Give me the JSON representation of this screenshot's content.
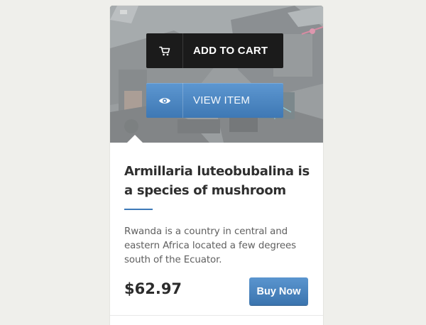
{
  "product": {
    "title": "Armillaria luteobubalina is a species of mushroom",
    "description": "Rwanda is a country in central and eastern Africa located a few degrees south of the Ecuator.",
    "price": "$62.97"
  },
  "overlay": {
    "add_to_cart_label": "ADD TO CART",
    "view_item_label": "VIEW ITEM"
  },
  "actions": {
    "buy_label": "Buy Now"
  },
  "icons": {
    "cart": "cart-icon",
    "view": "eye-icon"
  },
  "colors": {
    "accent": "#3d79b8",
    "cart_button": "#1b1b1b",
    "background": "#efefeb"
  }
}
